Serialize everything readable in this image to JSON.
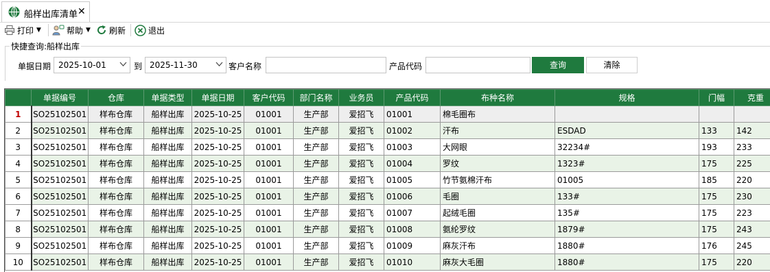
{
  "tab": {
    "title": "船样出库清单",
    "close": "✕"
  },
  "toolbar": {
    "print": "打印",
    "help": "帮助",
    "refresh": "刷新",
    "exit": "退出"
  },
  "query": {
    "group_title": "快捷查询:船样出库",
    "date_label": "单据日期",
    "date_from": "2025-10-01",
    "to_label": "到",
    "date_to": "2025-11-30",
    "customer_label": "客户名称",
    "customer_value": "",
    "product_label": "产品代码",
    "product_value": "",
    "query_button": "查询",
    "clear_button": "清除"
  },
  "grid": {
    "columns": [
      "单据编号",
      "仓库",
      "单据类型",
      "单据日期",
      "客户代码",
      "部门名称",
      "业务员",
      "产品代码",
      "布种名称",
      "规格",
      "门幅",
      "克重"
    ],
    "rows": [
      {
        "no": "1",
        "cells": [
          "SO25102501",
          "样布仓库",
          "船样出库",
          "2025-10-25",
          "01001",
          "生产部",
          "爱招飞",
          "01001",
          "棉毛圈布",
          "",
          "",
          ""
        ]
      },
      {
        "no": "2",
        "cells": [
          "SO25102501",
          "样布仓库",
          "船样出库",
          "2025-10-25",
          "01001",
          "生产部",
          "爱招飞",
          "01002",
          "汗布",
          "ESDAD",
          "133",
          "142"
        ]
      },
      {
        "no": "3",
        "cells": [
          "SO25102501",
          "样布仓库",
          "船样出库",
          "2025-10-25",
          "01001",
          "生产部",
          "爱招飞",
          "01003",
          "大网眼",
          "32234#",
          "193",
          "233"
        ]
      },
      {
        "no": "4",
        "cells": [
          "SO25102501",
          "样布仓库",
          "船样出库",
          "2025-10-25",
          "01001",
          "生产部",
          "爱招飞",
          "01004",
          "罗纹",
          "1323#",
          "175",
          "225"
        ]
      },
      {
        "no": "5",
        "cells": [
          "SO25102501",
          "样布仓库",
          "船样出库",
          "2025-10-25",
          "01001",
          "生产部",
          "爱招飞",
          "01005",
          "竹节氨棉汗布",
          "01005",
          "185",
          "220"
        ]
      },
      {
        "no": "6",
        "cells": [
          "SO25102501",
          "样布仓库",
          "船样出库",
          "2025-10-25",
          "01001",
          "生产部",
          "爱招飞",
          "01006",
          "毛圈",
          "133#",
          "175",
          "230"
        ]
      },
      {
        "no": "7",
        "cells": [
          "SO25102501",
          "样布仓库",
          "船样出库",
          "2025-10-25",
          "01001",
          "生产部",
          "爱招飞",
          "01007",
          "起绒毛圈",
          "135#",
          "175",
          "223"
        ]
      },
      {
        "no": "8",
        "cells": [
          "SO25102501",
          "样布仓库",
          "船样出库",
          "2025-10-25",
          "01001",
          "生产部",
          "爱招飞",
          "01008",
          "氨纶罗纹",
          "1879#",
          "175",
          "243"
        ]
      },
      {
        "no": "9",
        "cells": [
          "SO25102501",
          "样布仓库",
          "船样出库",
          "2025-10-25",
          "01001",
          "生产部",
          "爱招飞",
          "01009",
          "麻灰汗布",
          "1880#",
          "176",
          "245"
        ]
      },
      {
        "no": "10",
        "cells": [
          "SO25102501",
          "样布仓库",
          "船样出库",
          "2025-10-25",
          "01001",
          "生产部",
          "爱招飞",
          "01010",
          "麻灰大毛圈",
          "1880#",
          "175",
          "220"
        ]
      }
    ]
  }
}
